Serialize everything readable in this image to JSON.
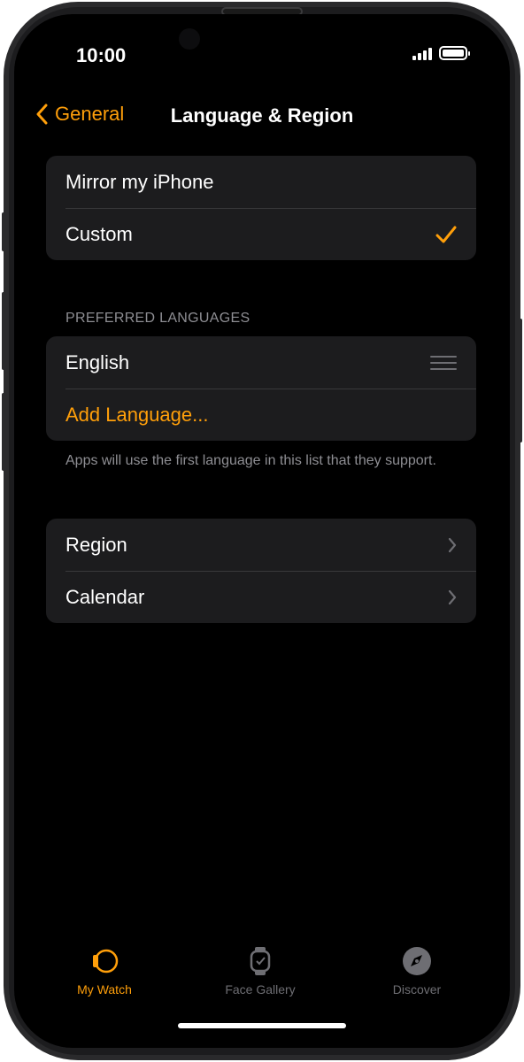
{
  "status_bar": {
    "time": "10:00"
  },
  "nav": {
    "back_label": "General",
    "title": "Language & Region"
  },
  "mode_group": {
    "items": [
      {
        "label": "Mirror my iPhone"
      },
      {
        "label": "Custom"
      }
    ]
  },
  "preferred_languages": {
    "header": "PREFERRED LANGUAGES",
    "language": "English",
    "add_label": "Add Language...",
    "footer": "Apps will use the first language in this list that they support."
  },
  "settings_group": {
    "items": [
      {
        "label": "Region"
      },
      {
        "label": "Calendar"
      }
    ]
  },
  "tabbar": {
    "tabs": [
      {
        "label": "My Watch",
        "icon": "my-watch-icon"
      },
      {
        "label": "Face Gallery",
        "icon": "face-gallery-icon"
      },
      {
        "label": "Discover",
        "icon": "discover-icon"
      }
    ]
  },
  "colors": {
    "accent": "#ff9f0a",
    "background": "#000000",
    "cell": "#1c1c1e",
    "secondary_text": "#8e8e93"
  }
}
